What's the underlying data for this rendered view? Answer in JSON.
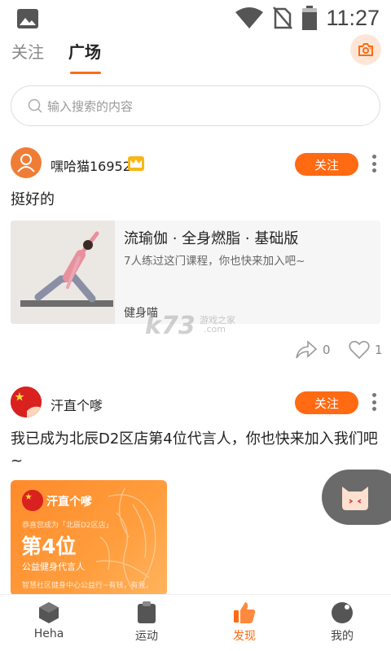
{
  "status_bar": {
    "time": "11:27",
    "icons": [
      "image-icon",
      "wifi-icon",
      "no-sim-icon",
      "battery-icon"
    ]
  },
  "tabs": [
    {
      "label": "关注",
      "active": false
    },
    {
      "label": "广场",
      "active": true
    }
  ],
  "search": {
    "placeholder": "输入搜索的内容"
  },
  "posts": [
    {
      "username": "嘿哈猫169524",
      "follow_label": "关注",
      "text": "挺好的",
      "card": {
        "title": "流瑜伽 · 全身燃脂 · 基础版",
        "subtitle": "7人练过这门课程，你也快来加入吧~",
        "tag": "健身喵"
      },
      "share_count": "0",
      "like_count": "1"
    },
    {
      "username": "汗直个嗲",
      "follow_label": "关注",
      "text_line1": "我已成为北辰D2区店第4位代言人，你也快来加入我们吧",
      "text_line2": "~",
      "card": {
        "name": "汗直个嗲",
        "congrats": "恭喜您成为「北辰D2区店」",
        "rank": "第4位",
        "role": "公益健身代言人",
        "desc": "智慧社区健身中心公益行~有钱，有我，"
      }
    }
  ],
  "watermark": {
    "logo": "k73",
    "site": "游戏之家",
    "domain": ".com"
  },
  "bottom_nav": [
    {
      "label": "Heha",
      "icon": "hexagon-icon",
      "active": false
    },
    {
      "label": "运动",
      "icon": "clipboard-icon",
      "active": false
    },
    {
      "label": "发现",
      "icon": "thumbs-up-icon",
      "active": true
    },
    {
      "label": "我的",
      "icon": "profile-icon",
      "active": false
    }
  ],
  "colors": {
    "accent": "#ff6a13",
    "floating": "#6a6a6a"
  }
}
